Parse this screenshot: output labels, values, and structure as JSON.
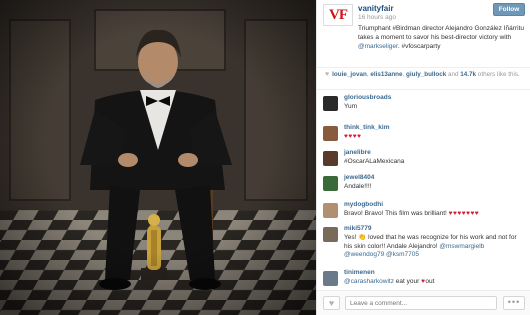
{
  "post": {
    "username": "vanityfair",
    "avatar_text": "VF",
    "time": "16 hours ago",
    "follow_label": "Follow",
    "caption_main": "Triumphant #Birdman director Alejandro González Iñárritu takes a moment to savor his best-director victory with ",
    "caption_mention": "@markseliger",
    "caption_tail": ". #vfoscarparty"
  },
  "likes": {
    "heart": "♥",
    "user1": "louie_jovan",
    "sep1": ", ",
    "user2": "elis13anne",
    "sep2": ", ",
    "user3": "giuly_bullock",
    "mid": " and ",
    "count": "14.7k",
    "tail": " others like this."
  },
  "comments": [
    {
      "user": "gloriousbroads",
      "text": "Yum",
      "avatar_color": "#2a2a2a"
    },
    {
      "user": "think_tink_kim",
      "text": "",
      "hearts": "♥♥♥♥",
      "avatar_color": "#8a5a3c"
    },
    {
      "user": "janelibre",
      "text": "#OscarALaMexicana",
      "avatar_color": "#5a3a2a"
    },
    {
      "user": "jewel8404",
      "text": "Andale!!!!",
      "avatar_color": "#3a6a3a"
    },
    {
      "user": "mydogbodhi",
      "text": "Bravo! Bravo! This film was brilliant! ",
      "hearts": "♥♥♥♥♥♥♥",
      "avatar_color": "#b09070"
    },
    {
      "user": "miki5779",
      "text_a": "Yes! ",
      "icon": "👏",
      "text_b": " loved that he was recognize for his work and not for his skin color!! Andale Alejandro! ",
      "mention1": "@mswmargielb",
      "mention2": "@weendog79",
      "sep": " ",
      "mention3": "@ksm7705",
      "avatar_color": "#7a6a5a"
    },
    {
      "user": "tinimenen",
      "mention": "@carasharkowitz",
      "text_a": " eat your ",
      "heart": "♥",
      "text_b": "out",
      "avatar_color": "#6a7a8a"
    }
  ],
  "footer": {
    "like_icon": "♥",
    "comment_placeholder": "Leave a comment...",
    "more_icon": "•••"
  }
}
